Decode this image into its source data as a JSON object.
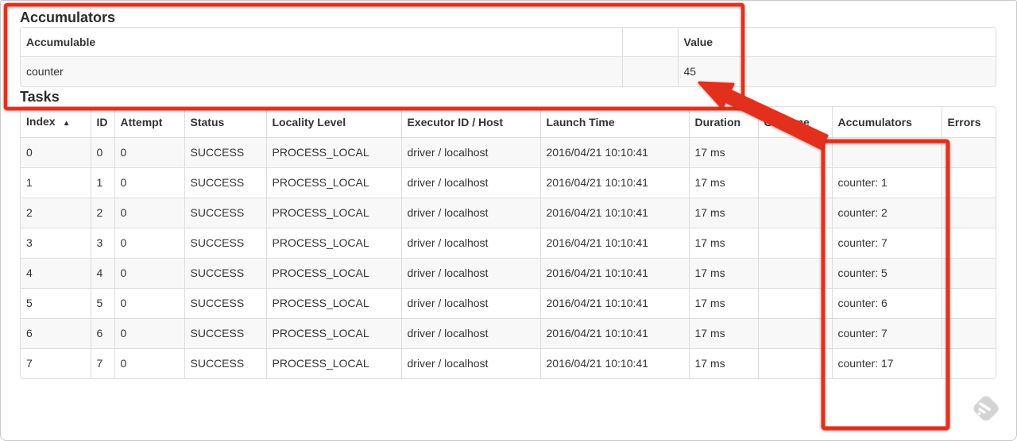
{
  "annotation": {
    "color": "#e2301d"
  },
  "accumulators": {
    "heading": "Accumulators",
    "columns": {
      "accumulable": "Accumulable",
      "spacer": "",
      "value": "Value"
    },
    "row": {
      "accumulable": "counter",
      "spacer": "",
      "value": "45"
    }
  },
  "tasks": {
    "heading": "Tasks",
    "sort_indicator": "▲",
    "columns": [
      "Index",
      "ID",
      "Attempt",
      "Status",
      "Locality Level",
      "Executor ID / Host",
      "Launch Time",
      "Duration",
      "GC Time",
      "Accumulators",
      "Errors"
    ],
    "rows": [
      [
        "0",
        "0",
        "0",
        "SUCCESS",
        "PROCESS_LOCAL",
        "driver / localhost",
        "2016/04/21 10:10:41",
        "17 ms",
        "",
        "",
        ""
      ],
      [
        "1",
        "1",
        "0",
        "SUCCESS",
        "PROCESS_LOCAL",
        "driver / localhost",
        "2016/04/21 10:10:41",
        "17 ms",
        "",
        "counter: 1",
        ""
      ],
      [
        "2",
        "2",
        "0",
        "SUCCESS",
        "PROCESS_LOCAL",
        "driver / localhost",
        "2016/04/21 10:10:41",
        "17 ms",
        "",
        "counter: 2",
        ""
      ],
      [
        "3",
        "3",
        "0",
        "SUCCESS",
        "PROCESS_LOCAL",
        "driver / localhost",
        "2016/04/21 10:10:41",
        "17 ms",
        "",
        "counter: 7",
        ""
      ],
      [
        "4",
        "4",
        "0",
        "SUCCESS",
        "PROCESS_LOCAL",
        "driver / localhost",
        "2016/04/21 10:10:41",
        "17 ms",
        "",
        "counter: 5",
        ""
      ],
      [
        "5",
        "5",
        "0",
        "SUCCESS",
        "PROCESS_LOCAL",
        "driver / localhost",
        "2016/04/21 10:10:41",
        "17 ms",
        "",
        "counter: 6",
        ""
      ],
      [
        "6",
        "6",
        "0",
        "SUCCESS",
        "PROCESS_LOCAL",
        "driver / localhost",
        "2016/04/21 10:10:41",
        "17 ms",
        "",
        "counter: 7",
        ""
      ],
      [
        "7",
        "7",
        "0",
        "SUCCESS",
        "PROCESS_LOCAL",
        "driver / localhost",
        "2016/04/21 10:10:41",
        "17 ms",
        "",
        "counter: 17",
        ""
      ]
    ]
  }
}
